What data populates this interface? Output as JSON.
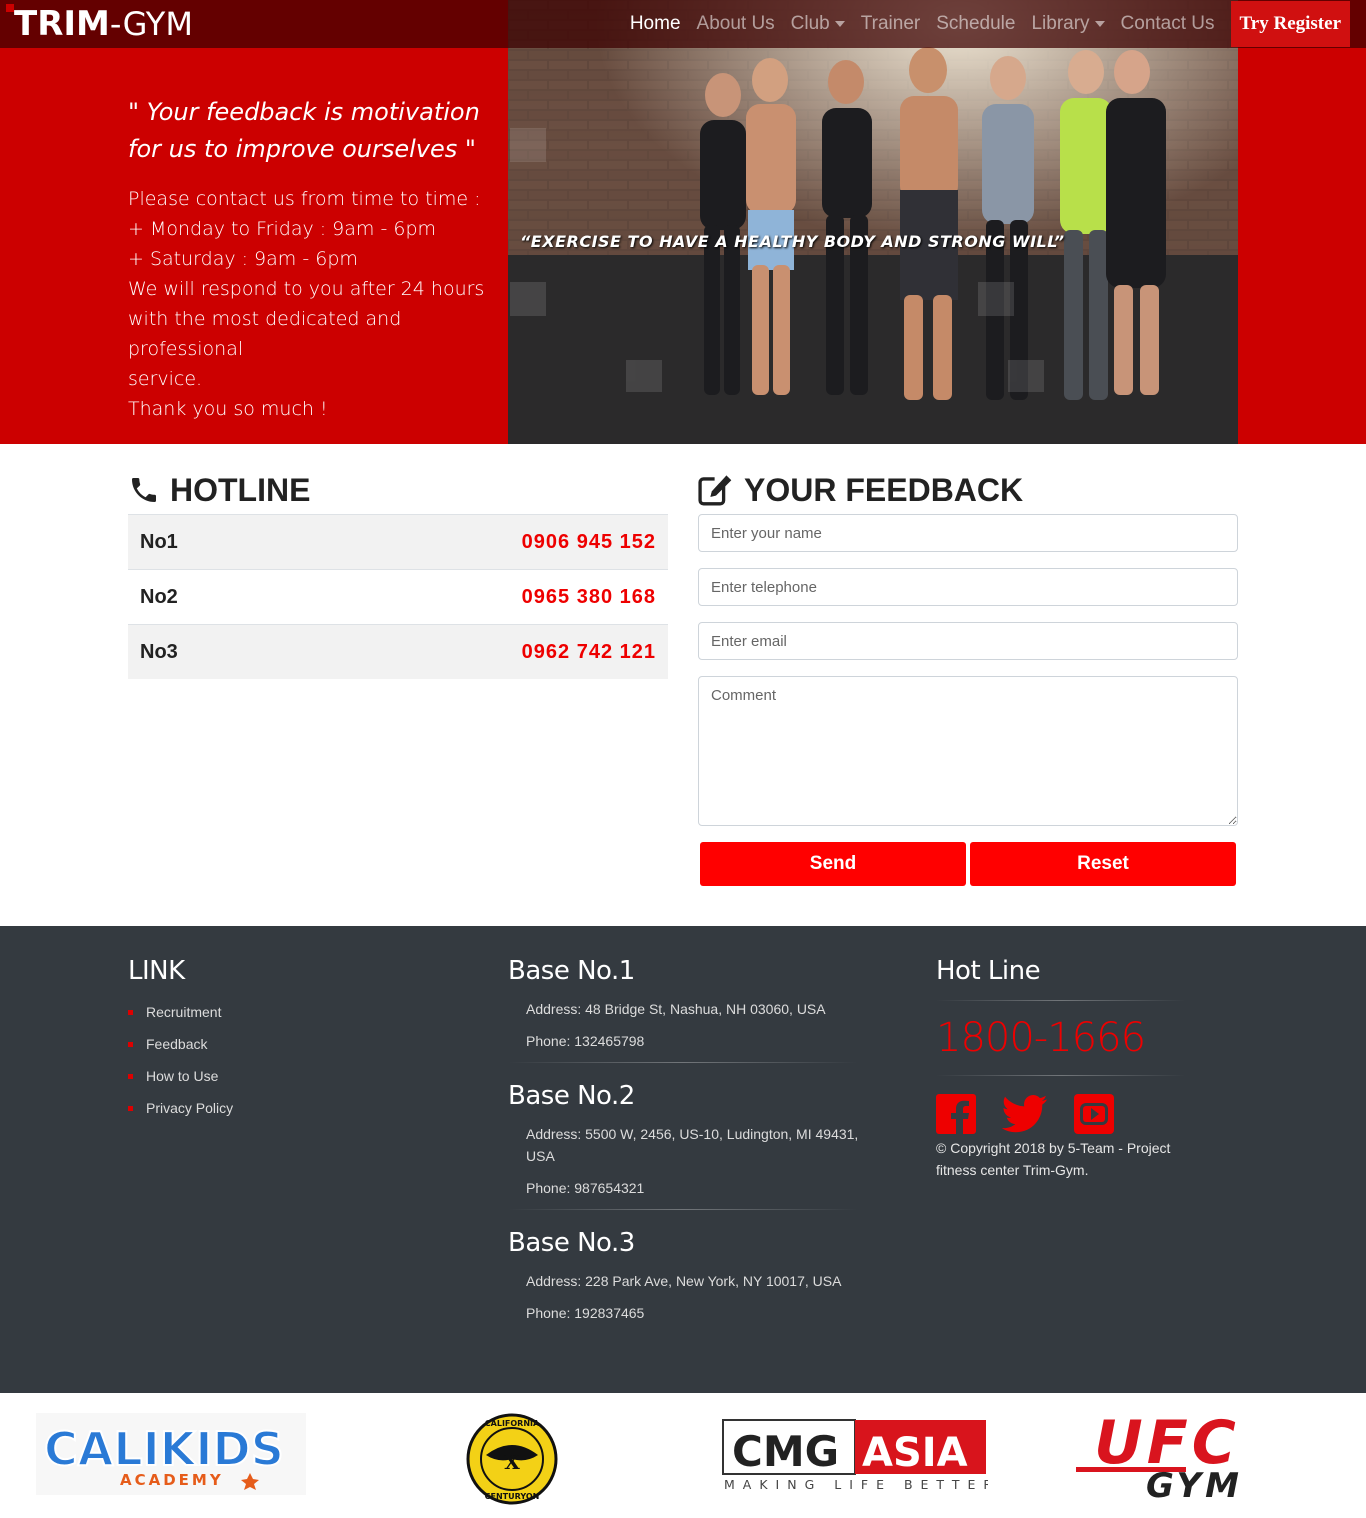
{
  "navbar": {
    "brand_bold": "TRIM",
    "brand_rest": "-GYM",
    "links": [
      "Home",
      "About Us",
      "Club",
      "Trainer",
      "Schedule",
      "Library",
      "Contact Us"
    ],
    "register": "Try Register"
  },
  "hero": {
    "quote_line1": "\" Your feedback is motivation",
    "quote_line2": "for us to improve ourselves \"",
    "lines": [
      "Please contact us from time to time :",
      "+ Monday to Friday : 9am - 6pm",
      "+ Saturday : 9am - 6pm",
      "We will respond to you after 24 hours",
      "with the most dedicated and professional",
      "service.",
      "Thank you so much !"
    ],
    "slogan": "“EXERCISE TO HAVE A HEALTHY BODY AND STRONG WILL”"
  },
  "hotline": {
    "title": "HOTLINE",
    "rows": [
      {
        "label": "No1",
        "number": "0906 945 152"
      },
      {
        "label": "No2",
        "number": "0965 380 168"
      },
      {
        "label": "No3",
        "number": "0962 742 121"
      }
    ]
  },
  "feedback": {
    "title": "YOUR FEEDBACK",
    "name_placeholder": "Enter your name",
    "tel_placeholder": "Enter telephone",
    "email_placeholder": "Enter email",
    "comment_placeholder": "Comment",
    "send": "Send",
    "reset": "Reset"
  },
  "footer": {
    "link_title": "LINK",
    "links": [
      "Recruitment",
      "Feedback",
      "How to Use",
      "Privacy Policy"
    ],
    "bases": [
      {
        "title": "Base No.1",
        "address": "Address: 48 Bridge St, Nashua, NH 03060, USA",
        "phone": "Phone: 132465798"
      },
      {
        "title": "Base No.2",
        "address": "Address: 5500 W, 2456, US-10, Ludington, MI 49431, USA",
        "phone": "Phone: 987654321"
      },
      {
        "title": "Base No.3",
        "address": "Address: 228 Park Ave, New York, NY 10017, USA",
        "phone": "Phone: 192837465"
      }
    ],
    "hotline_title": "Hot Line",
    "hotline_number": "1800-1666",
    "copyright": "© Copyright 2018 by 5-Team - Project fitness center Trim-Gym.",
    "social_icons": [
      "facebook-icon",
      "twitter-icon",
      "youtube-icon"
    ]
  },
  "partners": {
    "calikids_main": "CALIKIDS",
    "calikids_sub": "ACADEMY",
    "centuryon_top": "CALIFORNIA",
    "centuryon_bottom": "CENTURYON",
    "cmg_left": "CMG",
    "cmg_right": "ASIA",
    "cmg_tag": "MAKING LIFE BETTER",
    "ufc_top": "UFC",
    "ufc_bottom": "GYM"
  },
  "colors": {
    "accent_red": "#cc0000",
    "button_red": "#ff0000",
    "footer_bg": "#343a40"
  }
}
